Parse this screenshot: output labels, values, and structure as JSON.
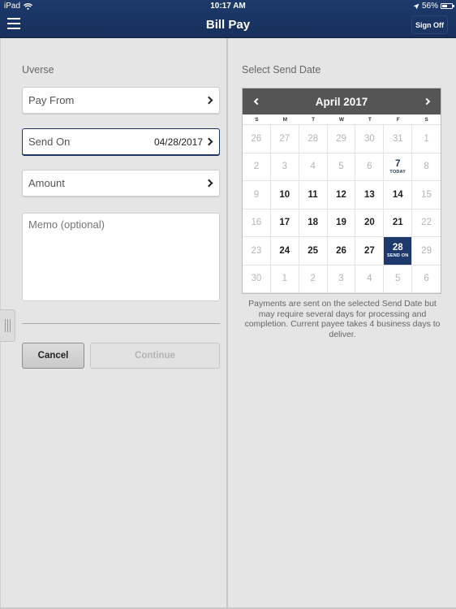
{
  "status_bar": {
    "device": "iPad",
    "time": "10:17 AM",
    "battery": "56%",
    "battery_level": 0.56
  },
  "header": {
    "title": "Bill Pay",
    "sign_off_label": "Sign Off"
  },
  "form": {
    "payee_name": "Uverse",
    "pay_from_label": "Pay From",
    "send_on_label": "Send On",
    "send_on_value": "04/28/2017",
    "amount_label": "Amount",
    "memo_placeholder": "Memo (optional)",
    "cancel_label": "Cancel",
    "continue_label": "Continue"
  },
  "calendar": {
    "section_label": "Select Send Date",
    "month_label": "April 2017",
    "weekdays": [
      "S",
      "M",
      "T",
      "W",
      "T",
      "F",
      "S"
    ],
    "days": [
      {
        "day": "26",
        "state": "muted"
      },
      {
        "day": "27",
        "state": "muted"
      },
      {
        "day": "28",
        "state": "muted"
      },
      {
        "day": "29",
        "state": "muted"
      },
      {
        "day": "30",
        "state": "muted"
      },
      {
        "day": "31",
        "state": "muted"
      },
      {
        "day": "1",
        "state": "muted"
      },
      {
        "day": "2",
        "state": "muted"
      },
      {
        "day": "3",
        "state": "muted"
      },
      {
        "day": "4",
        "state": "muted"
      },
      {
        "day": "5",
        "state": "muted"
      },
      {
        "day": "6",
        "state": "muted"
      },
      {
        "day": "7",
        "state": "today",
        "sub": "TODAY"
      },
      {
        "day": "8",
        "state": "muted"
      },
      {
        "day": "9",
        "state": "muted"
      },
      {
        "day": "10",
        "state": "enabled"
      },
      {
        "day": "11",
        "state": "enabled"
      },
      {
        "day": "12",
        "state": "enabled"
      },
      {
        "day": "13",
        "state": "enabled"
      },
      {
        "day": "14",
        "state": "enabled"
      },
      {
        "day": "15",
        "state": "muted"
      },
      {
        "day": "16",
        "state": "muted"
      },
      {
        "day": "17",
        "state": "enabled"
      },
      {
        "day": "18",
        "state": "enabled"
      },
      {
        "day": "19",
        "state": "enabled"
      },
      {
        "day": "20",
        "state": "enabled"
      },
      {
        "day": "21",
        "state": "enabled"
      },
      {
        "day": "22",
        "state": "muted"
      },
      {
        "day": "23",
        "state": "muted"
      },
      {
        "day": "24",
        "state": "enabled"
      },
      {
        "day": "25",
        "state": "enabled"
      },
      {
        "day": "26",
        "state": "enabled"
      },
      {
        "day": "27",
        "state": "enabled"
      },
      {
        "day": "28",
        "state": "selected",
        "sub": "SEND ON"
      },
      {
        "day": "29",
        "state": "muted"
      },
      {
        "day": "30",
        "state": "muted"
      },
      {
        "day": "1",
        "state": "muted"
      },
      {
        "day": "2",
        "state": "muted"
      },
      {
        "day": "3",
        "state": "muted"
      },
      {
        "day": "4",
        "state": "muted"
      },
      {
        "day": "5",
        "state": "muted"
      },
      {
        "day": "6",
        "state": "muted"
      }
    ],
    "note": "Payments are sent on the selected Send Date but may require several days for processing and completion. Current payee takes 4 business days to deliver."
  },
  "colors": {
    "header_bg": "#1d3a6b",
    "selected_day": "#1e3a6d",
    "calendar_header": "#555555"
  }
}
